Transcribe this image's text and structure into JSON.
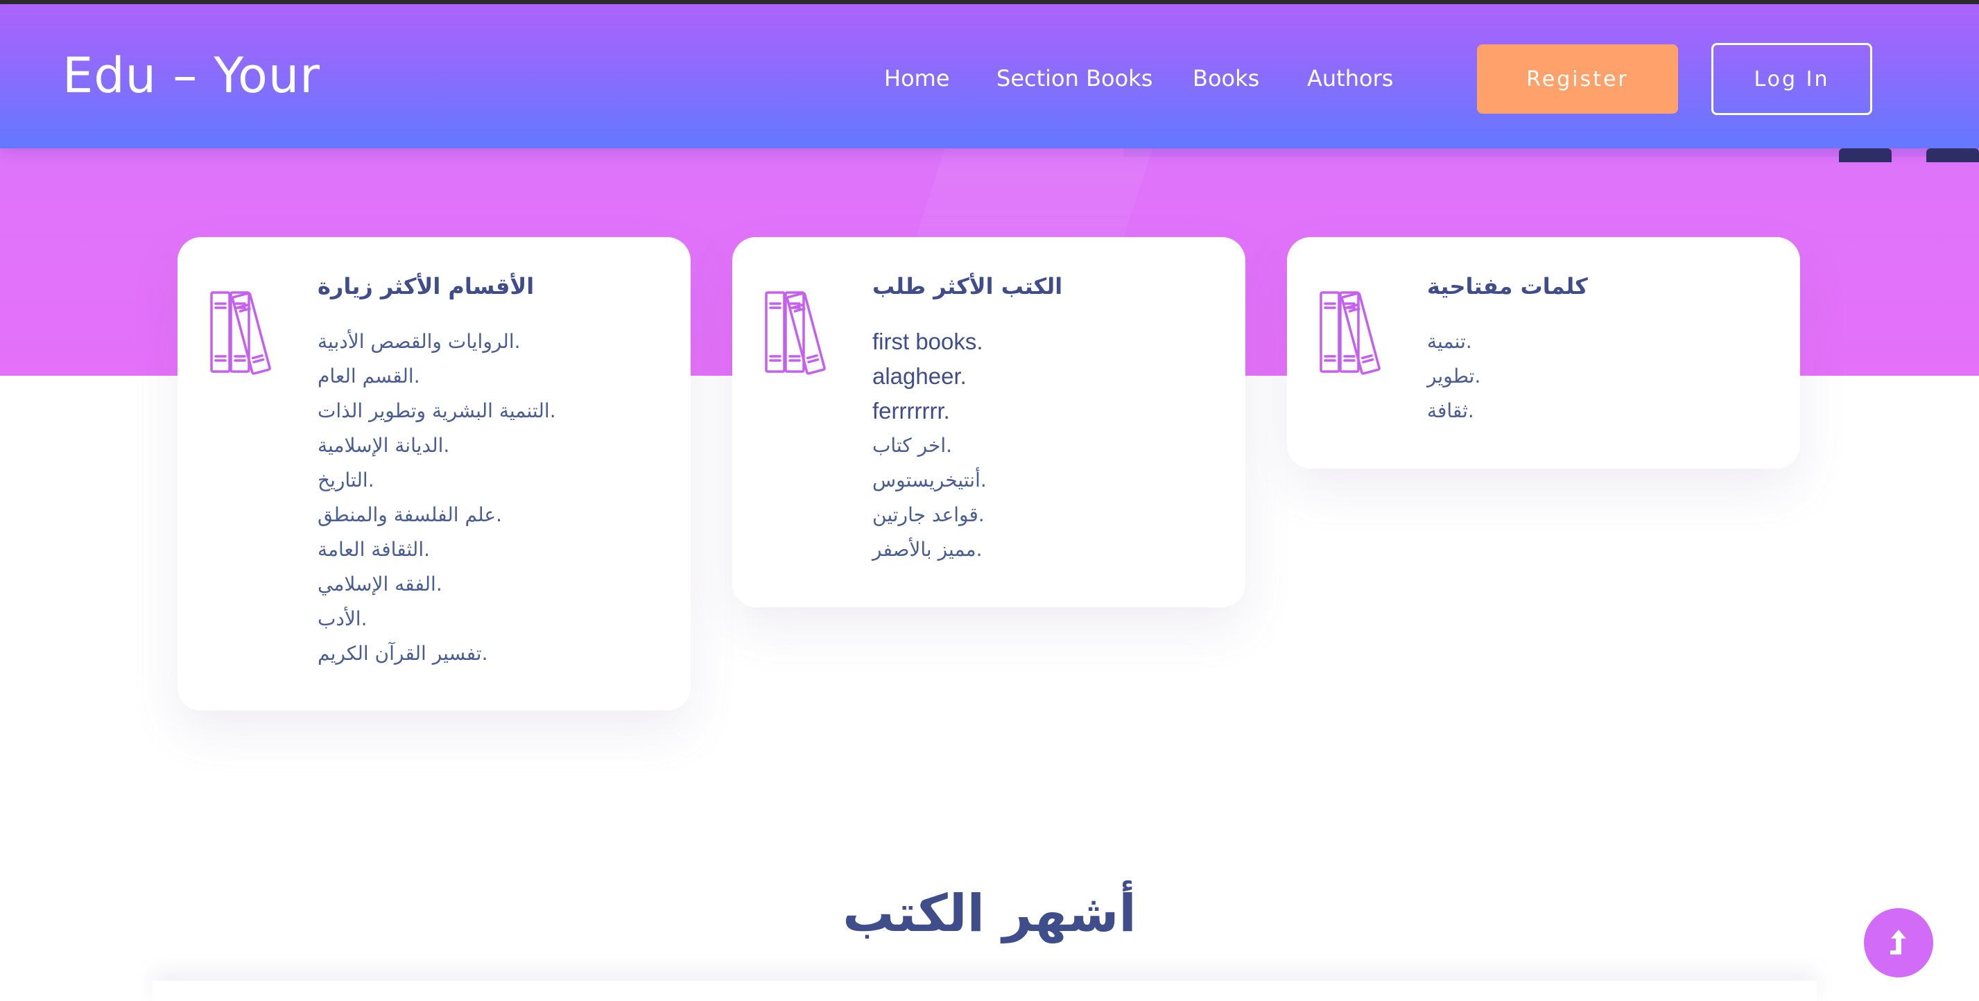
{
  "brand": "Edu – Your",
  "nav": {
    "links": [
      "Home",
      "Section Books",
      "Books",
      "Authors"
    ],
    "register_label": "Register",
    "login_label": "Log In"
  },
  "cards": [
    {
      "title": "الأقسام الأكثر زيارة",
      "items": [
        "الروايات والقصص الأدبية.",
        "القسم العام.",
        "التنمية البشرية وتطوير الذات.",
        "الديانة الإسلامية.",
        "التاريخ.",
        "علم الفلسفة والمنطق.",
        "الثقافة العامة.",
        "الفقه الإسلامي.",
        "الأدب.",
        "تفسير القرآن الكريم."
      ]
    },
    {
      "title": "الكتب الأكثر طلب",
      "items": [
        "first books.",
        "alagheer.",
        "ferrrrrrr.",
        "اخر كتاب.",
        "أنتيخريستوس.",
        "قواعد جارتين.",
        "مميز بالأصفر."
      ]
    },
    {
      "title": "كلمات مفتاحية",
      "items": [
        "تنمية.",
        "تطوير.",
        "ثقافة."
      ]
    }
  ],
  "section_title": "أشهر الكتب",
  "icons": {
    "card_icon": "books-icon",
    "scroll_top": "arrow-up-icon"
  },
  "colors": {
    "nav_gradient_top": "#ad62fb",
    "nav_gradient_bottom": "#6478ff",
    "hero_bg": "#e070fa",
    "register_button": "#fea16a",
    "heading_text": "#3f4e8a",
    "icon_stroke": "#c45ff0",
    "scroll_button": "#d36bf9"
  }
}
